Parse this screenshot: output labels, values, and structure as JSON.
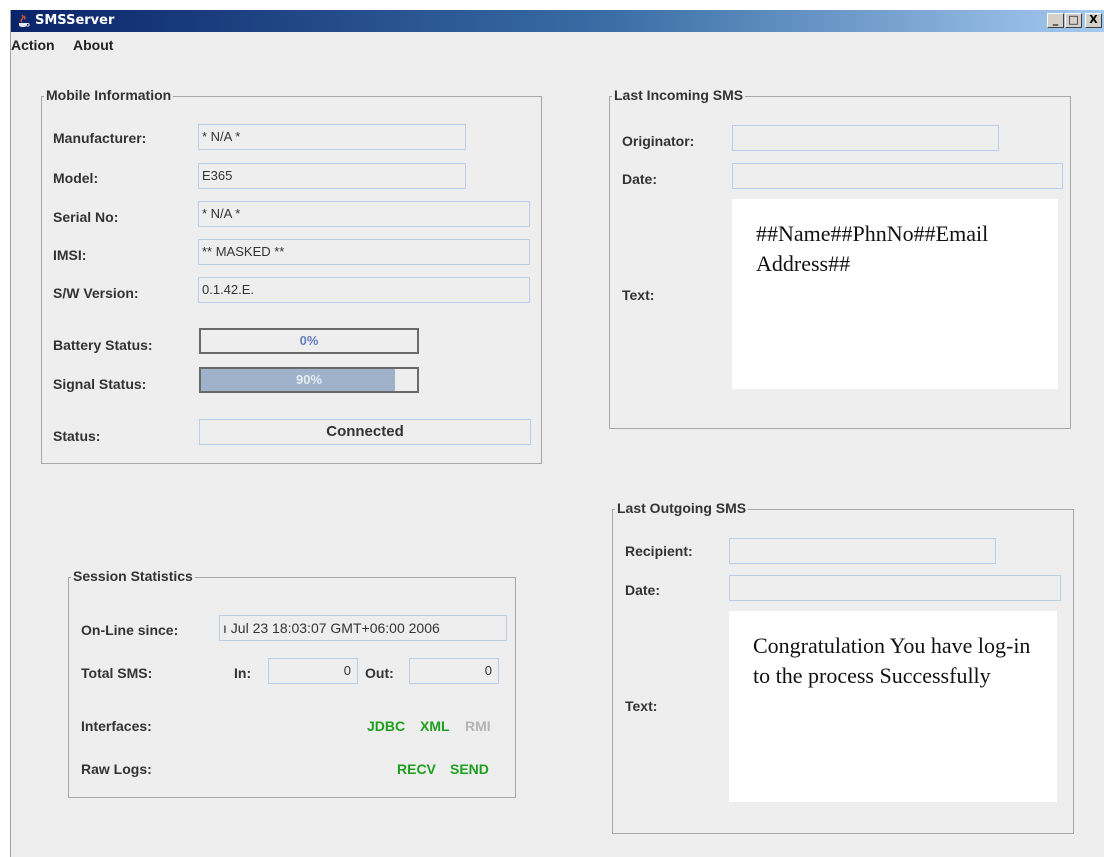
{
  "window": {
    "title": "SMSServer",
    "controls": [
      "_",
      "□",
      "X"
    ]
  },
  "menu": {
    "items": [
      "Action",
      "About"
    ]
  },
  "mobile": {
    "title": "Mobile Information",
    "rows": [
      {
        "label": "Manufacturer:",
        "value": "* N/A *"
      },
      {
        "label": "Model:",
        "value": "E365"
      },
      {
        "label": "Serial No:",
        "value": "* N/A *"
      },
      {
        "label": "IMSI:",
        "value": "** MASKED **"
      },
      {
        "label": "S/W Version:",
        "value": "0.1.42.E."
      }
    ],
    "battery": {
      "label": "Battery Status:",
      "text": "0%",
      "level": 0
    },
    "signal": {
      "label": "Signal Status:",
      "text": "90%",
      "level": 0.9
    },
    "status": {
      "label": "Status:",
      "value": "Connected"
    }
  },
  "incoming": {
    "title": "Last Incoming SMS",
    "originator_label": "Originator:",
    "originator_value": "",
    "date_label": "Date:",
    "date_value": "",
    "text_label": "Text:",
    "text": "##Name##PhnNo##Email Address##"
  },
  "outgoing": {
    "title": "Last Outgoing SMS",
    "recipient_label": "Recipient:",
    "recipient_value": "",
    "date_label": "Date:",
    "date_value": "",
    "text_label": "Text:",
    "text": "Congratulation You have log-in to the process Successfully"
  },
  "session": {
    "title": "Session Statistics",
    "online_label": "On-Line since:",
    "online_value": "ı Jul 23 18:03:07 GMT+06:00 2006",
    "total_label": "Total SMS:",
    "in_label": "In:",
    "in_value": "0",
    "out_label": "Out:",
    "out_value": "0",
    "interfaces_label": "Interfaces:",
    "interfaces": [
      {
        "name": "JDBC",
        "active": true
      },
      {
        "name": "XML",
        "active": true
      },
      {
        "name": "RMI",
        "active": false
      }
    ],
    "rawlogs_label": "Raw Logs:",
    "rawlogs": [
      {
        "name": "RECV",
        "active": true
      },
      {
        "name": "SEND",
        "active": true
      }
    ]
  },
  "colors": {
    "active": "#1ea01e",
    "inactive": "#b4b4b4",
    "title_bar": "#0a246a"
  }
}
